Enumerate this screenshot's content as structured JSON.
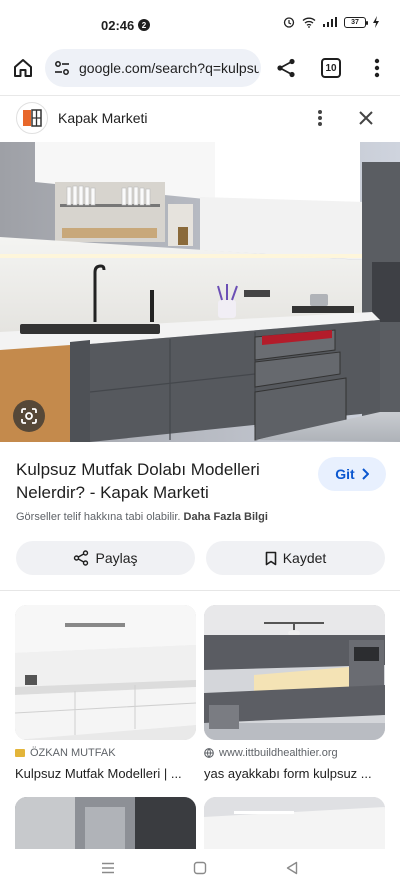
{
  "status_bar": {
    "time": "02:46",
    "notification_count": "2",
    "battery": "37"
  },
  "browser": {
    "url": "google.com/search?q=kulpsuz",
    "tab_count": "10"
  },
  "source": {
    "name": "Kapak Marketi"
  },
  "result": {
    "title": "Kulpsuz Mutfak Dolabı Modelleri Nelerdir? - Kapak Marketi",
    "visit_label": "Git",
    "copyright_text": "Görseller telif hakkına tabi olabilir.",
    "learn_more": "Daha Fazla Bilgi",
    "share_label": "Paylaş",
    "save_label": "Kaydet"
  },
  "related": [
    {
      "source": "ÖZKAN MUTFAK",
      "caption": "Kulpsuz Mutfak Modelleri | ..."
    },
    {
      "source": "www.ittbuildhealthier.org",
      "caption": "yas ayakkabı form kulpsuz ..."
    }
  ],
  "colors": {
    "accent": "#0b57d0",
    "pill_bg": "#f0f1f4",
    "url_bg": "#eef1f7",
    "logo_orange": "#e8672a"
  }
}
